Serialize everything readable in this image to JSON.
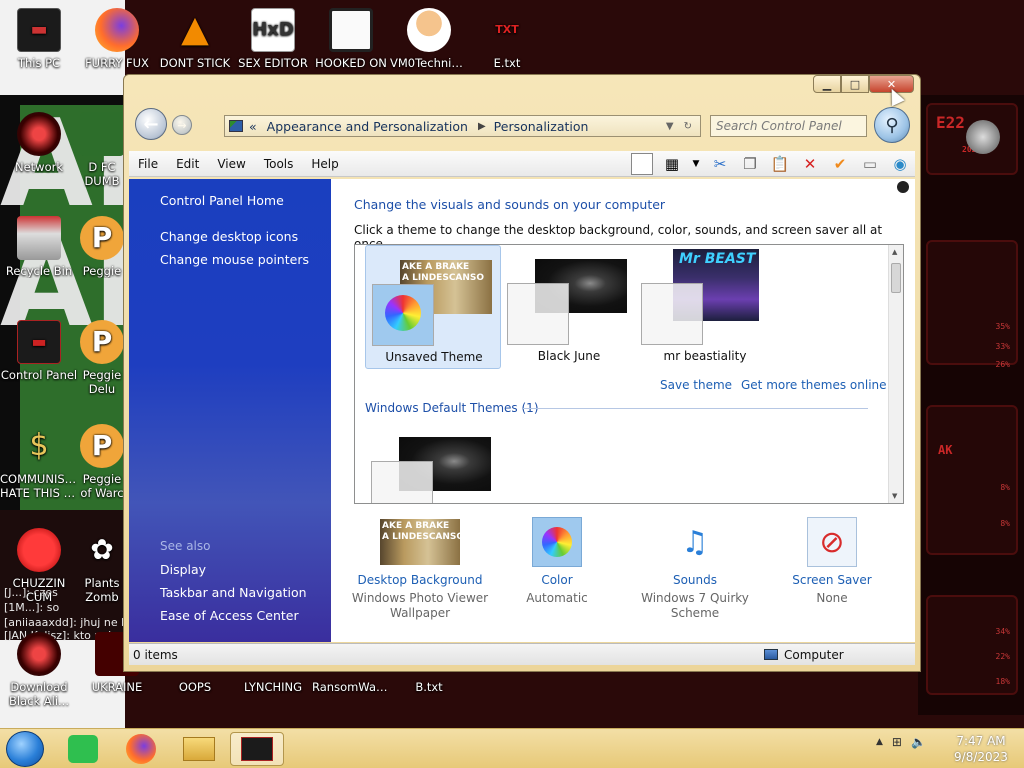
{
  "desktop": {
    "icons": [
      {
        "label": "This PC",
        "icon": "computer-icon"
      },
      {
        "label": "FURRY FUX",
        "icon": "firefox-icon"
      },
      {
        "label": "DONT STICK",
        "icon": "vlc-icon"
      },
      {
        "label": "SEX EDITOR",
        "icon": "hxd-icon"
      },
      {
        "label": "HOOKED ON",
        "icon": "app-icon"
      },
      {
        "label": "VM0Technic...",
        "icon": "person-icon"
      },
      {
        "label": "E.txt",
        "icon": "txt-icon"
      },
      {
        "label": "Network",
        "icon": "network-icon"
      },
      {
        "label": "D FC",
        "label2": "DUMB",
        "icon": "app-icon"
      },
      {
        "label": "Recycle Bin",
        "icon": "recycle-bin-icon"
      },
      {
        "label": "Peggie",
        "icon": "p-icon"
      },
      {
        "label": "Control Panel",
        "icon": "control-panel-icon"
      },
      {
        "label": "Peggie",
        "label2": "Delu",
        "icon": "p-icon"
      },
      {
        "label": "COMMUNISTS",
        "label2": "HATE THIS G...",
        "icon": "money-bag-icon"
      },
      {
        "label": "Peggie",
        "label2": "of Warc",
        "icon": "p-icon"
      },
      {
        "label": "CHUZZIN",
        "label2": "CUM",
        "icon": "chuzzle-icon"
      },
      {
        "label": "Plants",
        "label2": "Zomb",
        "icon": "plant-icon"
      },
      {
        "label": "Download",
        "label2": "Black Ali...",
        "icon": "alienware-icon"
      },
      {
        "label": "UKRAINE",
        "icon": "app-icon"
      },
      {
        "label": "OOPS",
        "icon": "app-icon"
      },
      {
        "label": "LYNCHING",
        "icon": "app-icon"
      },
      {
        "label": "RansomWar...",
        "icon": "app-icon"
      },
      {
        "label": "B.txt",
        "icon": "txt-icon"
      }
    ],
    "chat_lines": [
      "[J...]: czes",
      "[1M...]: so",
      "[aniiaaaxdd]: jhuj ne b",
      "[JAN Kalisz]: kto pola"
    ],
    "wallpaper_letters": "AK\nAI",
    "hud_pcts": [
      "35%",
      "33%",
      "26%",
      "8%",
      "8%",
      "34%",
      "22%",
      "18%"
    ],
    "hud_texts": [
      "E22",
      "2023",
      "AK"
    ]
  },
  "window": {
    "address": {
      "chevrons": "«",
      "crumbs": [
        "Appearance and Personalization",
        "Personalization"
      ]
    },
    "search_placeholder": "Search Control Panel",
    "menu": [
      "File",
      "Edit",
      "View",
      "Tools",
      "Help"
    ],
    "sidebar": {
      "home": "Control Panel Home",
      "links": [
        "Change desktop icons",
        "Change mouse pointers"
      ],
      "see_also_header": "See also",
      "see_also": [
        "Display",
        "Taskbar and Navigation",
        "Ease of Access Center"
      ]
    },
    "main": {
      "heading": "Change the visuals and sounds on your computer",
      "subheading": "Click a theme to change the desktop background, color, sounds, and screen saver all at once.",
      "themes": [
        {
          "name": "Unsaved Theme",
          "selected": true
        },
        {
          "name": "Black June",
          "selected": false
        },
        {
          "name": "mr beastiality",
          "selected": false
        }
      ],
      "save_theme": "Save theme",
      "get_more": "Get more themes online",
      "group_header": "Windows Default Themes (1)",
      "thumb_text": "AKE A BRAKE\nA LINDESCANSO",
      "beast_text": "Mr BEAST"
    },
    "options": [
      {
        "name": "Desktop Background",
        "value": "Windows Photo Viewer Wallpaper",
        "icon": "desktop-background-icon"
      },
      {
        "name": "Color",
        "value": "Automatic",
        "icon": "color-palette-icon"
      },
      {
        "name": "Sounds",
        "value": "Windows 7 Quirky Scheme",
        "icon": "music-notes-icon"
      },
      {
        "name": "Screen Saver",
        "value": "None",
        "icon": "screen-saver-icon"
      }
    ],
    "status": {
      "items": "0 items",
      "location": "Computer"
    }
  },
  "taskbar": {
    "time": "7:47 AM",
    "date": "9/8/2023"
  }
}
